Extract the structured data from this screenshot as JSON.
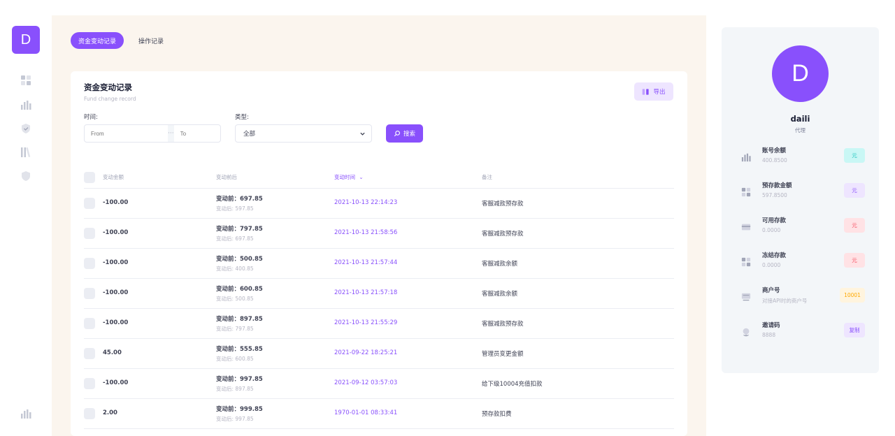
{
  "rail": {
    "logo_letter": "D"
  },
  "tabs": [
    {
      "label": "资金变动记录",
      "active": true
    },
    {
      "label": "操作记录",
      "active": false
    }
  ],
  "card": {
    "title": "资金变动记录",
    "subtitle": "Fund change record",
    "export_label": "导出"
  },
  "filters": {
    "time_label": "时间:",
    "from_placeholder": "From",
    "separator": "···",
    "to_placeholder": "To",
    "type_label": "类型:",
    "type_selected": "全部",
    "search_label": "搜索"
  },
  "table": {
    "headers": {
      "amount": "变动金额",
      "before_after": "变动前后",
      "time": "变动时间",
      "note": "备注"
    },
    "rows": [
      {
        "amount": "-100.00",
        "before": "变动前：697.85",
        "after": "变动后: 597.85",
        "time": "2021-10-13 22:14:23",
        "note": "客服减款预存款"
      },
      {
        "amount": "-100.00",
        "before": "变动前：797.85",
        "after": "变动后: 697.85",
        "time": "2021-10-13 21:58:56",
        "note": "客服减款预存款"
      },
      {
        "amount": "-100.00",
        "before": "变动前：500.85",
        "after": "变动后: 400.85",
        "time": "2021-10-13 21:57:44",
        "note": "客服减款余额"
      },
      {
        "amount": "-100.00",
        "before": "变动前：600.85",
        "after": "变动后: 500.85",
        "time": "2021-10-13 21:57:18",
        "note": "客服减款余额"
      },
      {
        "amount": "-100.00",
        "before": "变动前：897.85",
        "after": "变动后: 797.85",
        "time": "2021-10-13 21:55:29",
        "note": "客服减款预存款"
      },
      {
        "amount": "45.00",
        "before": "变动前：555.85",
        "after": "变动后: 600.85",
        "time": "2021-09-22 18:25:21",
        "note": "管理员变更金额"
      },
      {
        "amount": "-100.00",
        "before": "变动前：997.85",
        "after": "变动后: 897.85",
        "time": "2021-09-12 03:57:03",
        "note": "给下级10004充值扣款"
      },
      {
        "amount": "2.00",
        "before": "变动前：999.85",
        "after": "变动后: 997.85",
        "time": "1970-01-01 08:33:41",
        "note": "预存款扣费"
      }
    ]
  },
  "profile": {
    "avatar_letter": "D",
    "name": "daili",
    "role": "代理",
    "stats": [
      {
        "label": "账号余额",
        "value": "400.8500",
        "badge": "元",
        "badge_bg": "#c9f7f5",
        "badge_fg": "#1bc5bd",
        "icon": "bar-chart-icon"
      },
      {
        "label": "预存款金额",
        "value": "597.8500",
        "badge": "元",
        "badge_bg": "#eee5ff",
        "badge_fg": "#8950fc",
        "icon": "grid-icon"
      },
      {
        "label": "可用存款",
        "value": "0.0000",
        "badge": "元",
        "badge_bg": "#ffe2e5",
        "badge_fg": "#f64e60",
        "icon": "card-icon"
      },
      {
        "label": "冻结存款",
        "value": "0.0000",
        "badge": "元",
        "badge_bg": "#ffe2e5",
        "badge_fg": "#f64e60",
        "icon": "grid-icon"
      },
      {
        "label": "商户号",
        "value": "对接API时的商户号",
        "badge": "10001",
        "badge_bg": "#fff4de",
        "badge_fg": "#ffa800",
        "icon": "terminal-icon"
      },
      {
        "label": "邀请码",
        "value": "8888",
        "badge": "复制",
        "badge_bg": "#eee5ff",
        "badge_fg": "#8950fc",
        "icon": "globe-icon"
      }
    ]
  },
  "colors": {
    "accent": "#8950fc",
    "accent_light": "#eee5ff",
    "content_bg": "#fbf5ee",
    "panel_bg": "#f3f6f9"
  }
}
